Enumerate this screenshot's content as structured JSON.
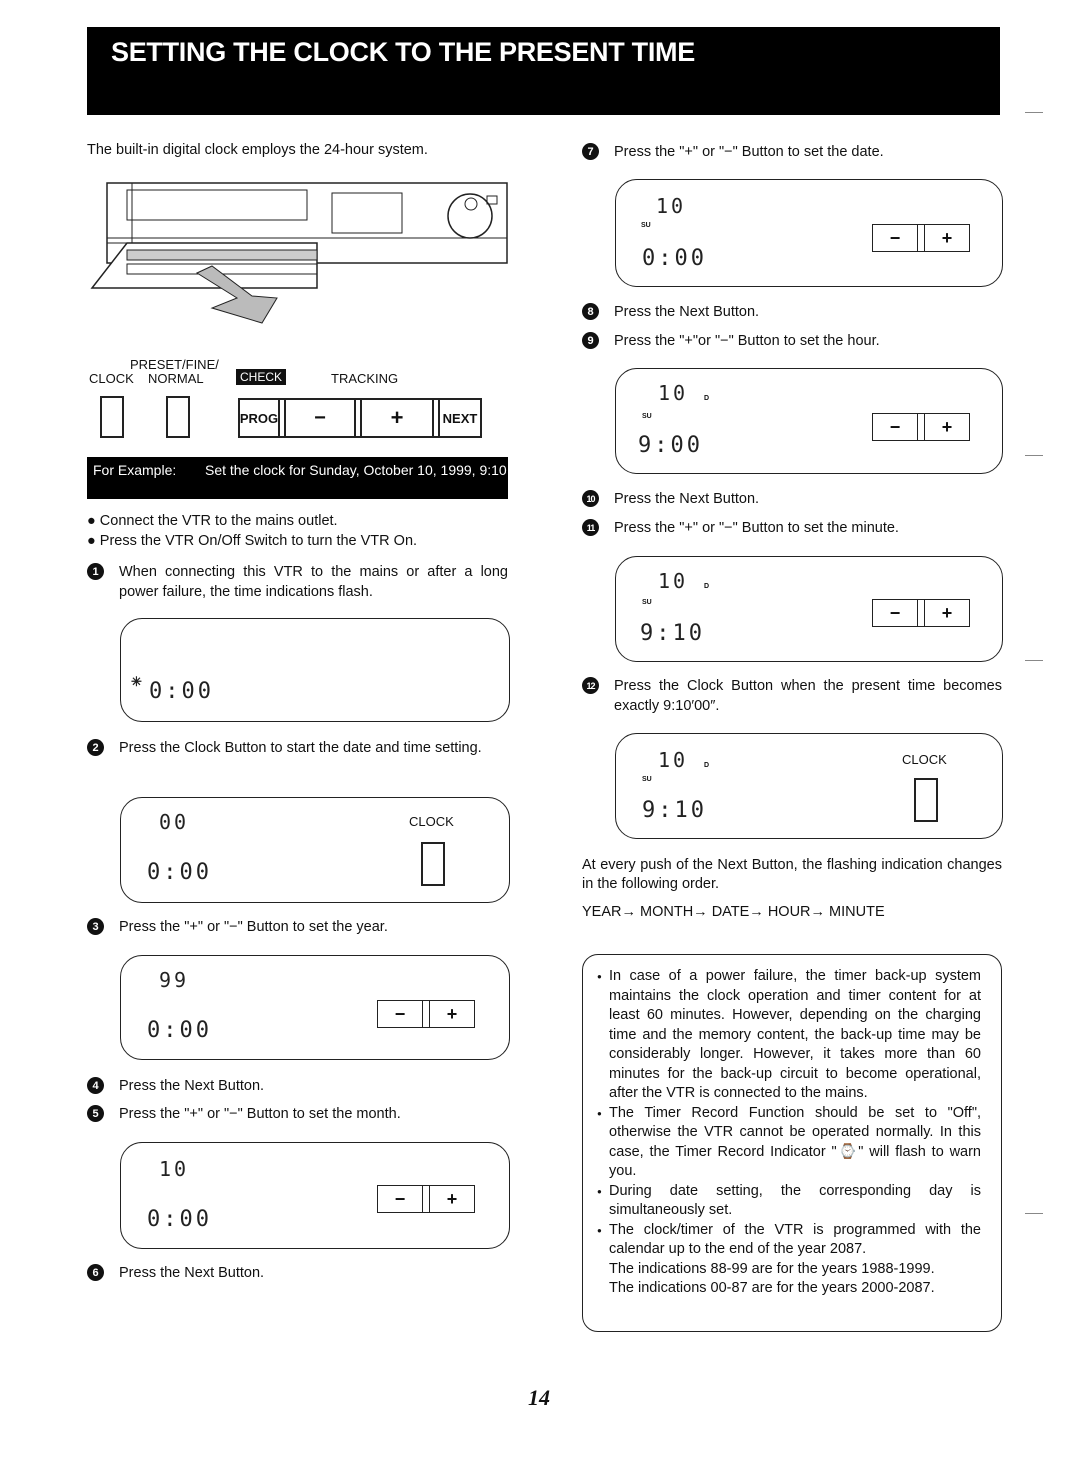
{
  "header": {
    "title": "SETTING THE CLOCK TO THE PRESENT TIME"
  },
  "intro": "The built-in digital clock employs the 24-hour system.",
  "controls": {
    "clock_label": "CLOCK",
    "preset_label_1": "PRESET/FINE/",
    "preset_label_2": "NORMAL",
    "check_label": "CHECK",
    "tracking_label": "TRACKING",
    "prog": "PROG",
    "minus": "−",
    "plus": "+",
    "next": "NEXT"
  },
  "example": {
    "label": "For Example:",
    "text": "Set the clock for Sunday, October 10, 1999, 9:10"
  },
  "prereqs": [
    "Connect the VTR to the mains outlet.",
    "Press the VTR On/Off Switch to turn the VTR On."
  ],
  "steps": [
    {
      "n": "1",
      "text": "When connecting this VTR to the mains or after a long power failure, the time indications flash."
    },
    {
      "n": "2",
      "text": "Press the Clock Button to start the date and time setting."
    },
    {
      "n": "3",
      "text": "Press the \"+\" or \"−\" Button to set the year."
    },
    {
      "n": "4",
      "text": "Press the Next Button."
    },
    {
      "n": "5",
      "text": "Press the \"+\" or \"−\" Button to set the month."
    },
    {
      "n": "6",
      "text": "Press the Next Button."
    },
    {
      "n": "7",
      "text": "Press the \"+\" or \"−\" Button to set the date."
    },
    {
      "n": "8",
      "text": "Press the Next Button."
    },
    {
      "n": "9",
      "text": "Press the \"+\"or \"−\" Button to set the hour."
    },
    {
      "n": "10",
      "text": "Press the Next Button."
    },
    {
      "n": "11",
      "text": "Press the \"+\" or \"−\" Button to set the minute."
    },
    {
      "n": "12",
      "text": "Press the Clock Button when the present time becomes exactly 9:10′00″."
    }
  ],
  "displays": {
    "d1": {
      "time": "0:00"
    },
    "d2": {
      "top": "00",
      "time": "0:00",
      "clock": "CLOCK"
    },
    "d3": {
      "top": "99",
      "time": "0:00"
    },
    "d5": {
      "top": "10",
      "time": "0:00"
    },
    "d7": {
      "top": "10",
      "day": "SU",
      "time": "0:00"
    },
    "d9": {
      "top": "10",
      "suffix": "D",
      "day": "SU",
      "time": "9:00"
    },
    "d11": {
      "top": "10",
      "suffix": "D",
      "day": "SU",
      "time": "9:10"
    },
    "d12": {
      "top": "10",
      "suffix": "D",
      "day": "SU",
      "time": "9:10",
      "clock": "CLOCK"
    }
  },
  "next_order_text": "At every push of the Next Button, the flashing indication changes in the following order.",
  "next_order": "YEAR→ MONTH→ DATE→ HOUR→ MINUTE",
  "notes": [
    "In case of a power failure, the timer back-up system maintains the clock operation and timer content for at least 60 minutes. However, depending on the charging time and the memory content, the back-up time may be considerably longer. However, it takes more than 60 minutes for the back-up circuit to become operational, after the VTR is connected to the mains.",
    "The Timer Record Function should be set to \"Off\", otherwise the VTR cannot be operated normally. In this case, the Timer Record Indicator \"⌚\" will flash to warn you.",
    "During date setting, the corresponding day is simultaneously set.",
    "The clock/timer of the VTR is programmed with the calendar up to the end of the year 2087."
  ],
  "notes_extra": [
    "The indications 88-99 are for the years 1988-1999.",
    "The indications 00-87 are for the years 2000-2087."
  ],
  "page_number": "14"
}
